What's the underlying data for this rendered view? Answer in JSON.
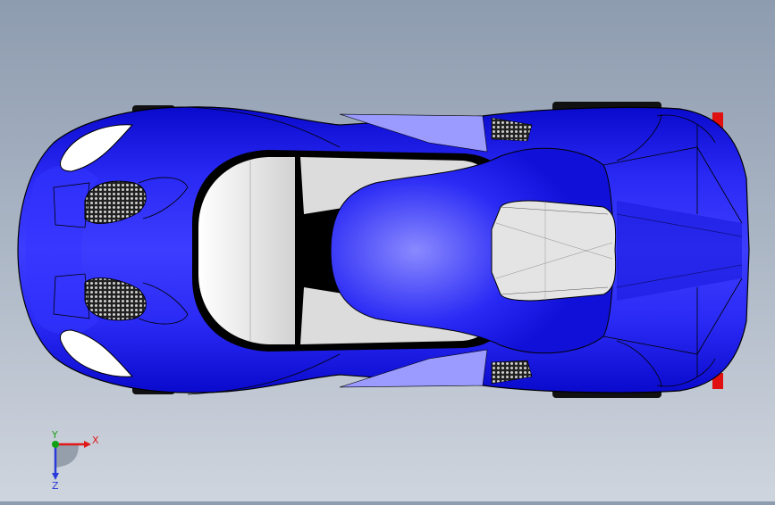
{
  "viewport": {
    "background_top": "#8e9cb0",
    "background_bottom": "#cfd5de"
  },
  "model": {
    "body_color": "#1414e6",
    "glass_color": "#e2e2e2",
    "tire_color": "#111111",
    "tail_light_color": "#e01010"
  },
  "triad": {
    "x_label": "X",
    "y_label": "Y",
    "z_label": "Z",
    "x_color": "#e01818",
    "y_color": "#14a014",
    "z_color": "#2a3ad8"
  }
}
